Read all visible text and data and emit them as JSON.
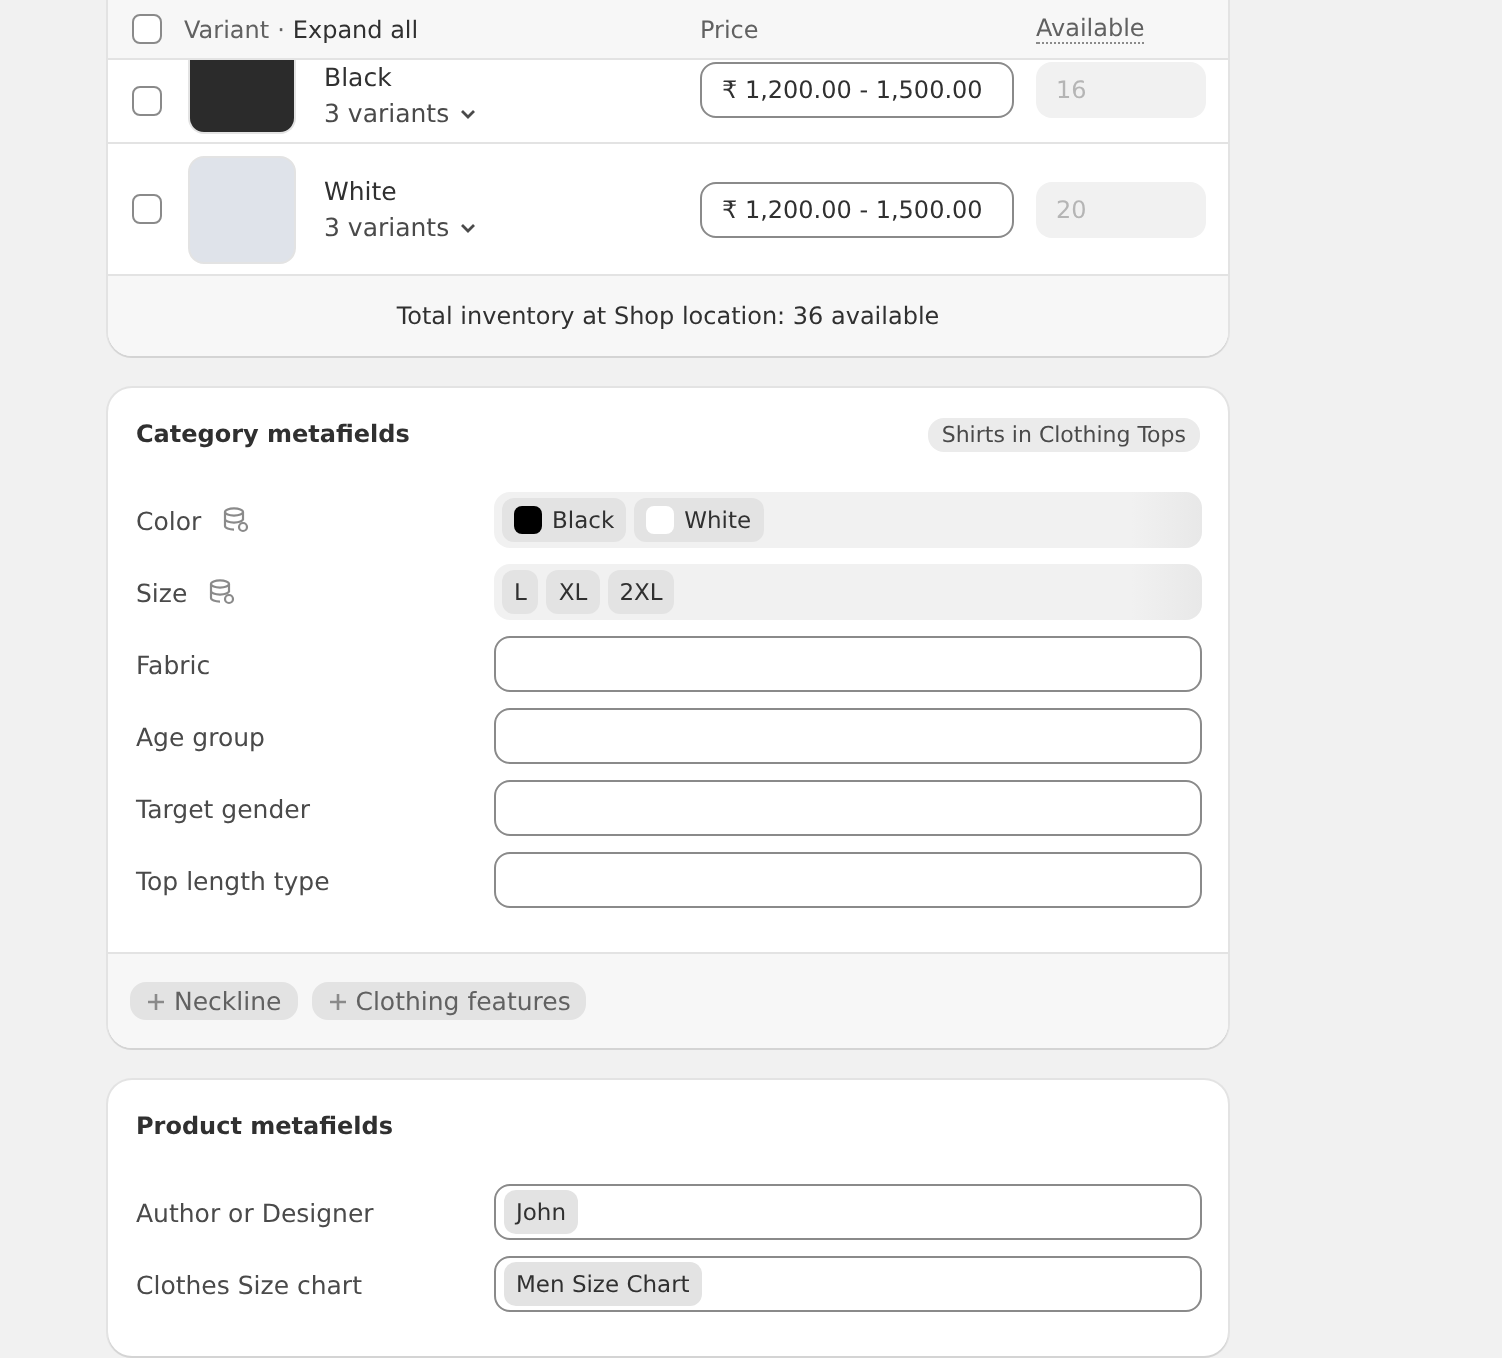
{
  "variants_table": {
    "header": {
      "checked": false,
      "variant_label": "Variant",
      "separator": "·",
      "expand_link": "Expand all",
      "price_label": "Price",
      "available_label": "Available"
    },
    "rows": [
      {
        "name": "Black",
        "variants": "3 variants",
        "checked": false,
        "price": "₹ 1,200.00 - 1,500.00",
        "available": "16",
        "available_disabled": true,
        "cut_top": true
      },
      {
        "name": "White",
        "variants": "3 variants",
        "checked": false,
        "price": "₹ 1,200.00 - 1,500.00",
        "available": "20",
        "available_disabled": true,
        "cut_top": false
      }
    ],
    "footer": "Total inventory at Shop location: 36 available"
  },
  "category_metafields": {
    "title": "Category metafields",
    "badge": "Shirts in Clothing Tops",
    "fields": [
      {
        "label": "Color",
        "linked": true,
        "kind": "swatches",
        "chips": [
          {
            "label": "Black",
            "color": "#000000"
          },
          {
            "label": "White",
            "color": "#ffffff"
          }
        ]
      },
      {
        "label": "Size",
        "linked": true,
        "kind": "chips",
        "chips": [
          {
            "label": "L"
          },
          {
            "label": "XL"
          },
          {
            "label": "2XL"
          }
        ]
      },
      {
        "label": "Fabric",
        "linked": false,
        "kind": "text"
      },
      {
        "label": "Age group",
        "linked": false,
        "kind": "text"
      },
      {
        "label": "Target gender",
        "linked": false,
        "kind": "text"
      },
      {
        "label": "Top length type",
        "linked": false,
        "kind": "text"
      }
    ],
    "add_buttons": [
      "Neckline",
      "Clothing features"
    ]
  },
  "product_metafields": {
    "title": "Product metafields",
    "fields": [
      {
        "label": "Author or Designer",
        "kind": "reference",
        "chips": [
          {
            "label": "John"
          }
        ]
      },
      {
        "label": "Clothes Size chart",
        "kind": "reference",
        "chips": [
          {
            "label": "Men Size Chart"
          }
        ]
      }
    ]
  }
}
